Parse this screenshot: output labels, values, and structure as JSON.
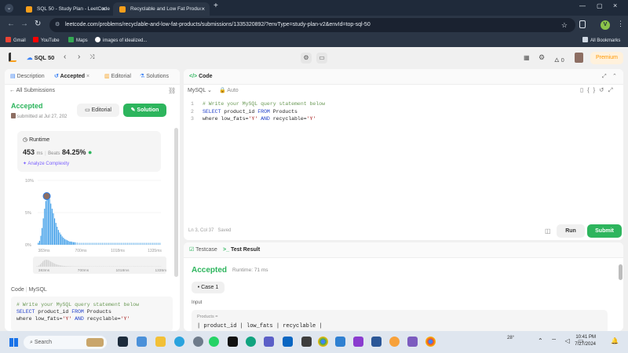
{
  "browser": {
    "tabs": [
      {
        "title": "SQL 50 - Study Plan - LeetCode",
        "active": false
      },
      {
        "title": "Recyclable and Low Fat Products",
        "active": true
      }
    ],
    "new_tab": "+",
    "url": "leetcode.com/problems/recyclable-and-low-fat-products/submissions/1335320892/?envType=study-plan-v2&envId=top-sql-50",
    "profile_initial": "V",
    "bookmarks": [
      "Gmail",
      "YouTube",
      "Maps",
      "images of idealized..."
    ],
    "all_bookmarks": "All Bookmarks"
  },
  "leetcode_nav": {
    "study_plan": "SQL 50",
    "streak_count": "0",
    "premium_label": "Premium"
  },
  "left_panel": {
    "tabs": [
      "Description",
      "Accepted",
      "Editorial",
      "Solutions"
    ],
    "all_submissions": "All Submissions",
    "status": "Accepted",
    "submitted_text": "submitted at Jul 27, 202",
    "editorial_button": "Editorial",
    "solution_button": "Solution",
    "runtime_label": "Runtime",
    "runtime_value": "453",
    "runtime_unit": "ms",
    "beats_label": "Beats",
    "beats_value": "84.25%",
    "analyze_label": "Analyze Complexity",
    "code_label": "Code",
    "lang_label": "MySQL",
    "code_lines": [
      "# Write your MySQL query statement below",
      "SELECT product_id FROM Products",
      "where low_fats='Y' AND recyclable='Y'"
    ]
  },
  "chart_data": {
    "type": "bar",
    "title": "",
    "xlabel": "",
    "ylabel": "",
    "y_ticks": [
      "10%",
      "5%",
      "0%"
    ],
    "x_ticks": [
      "383ms",
      "700ms",
      "1018ms",
      "1335ms"
    ],
    "mini_x_ticks": [
      "383ms",
      "700ms",
      "1018ms",
      "1335ms"
    ],
    "xlim": [
      383,
      1335
    ],
    "ylim": [
      0,
      10
    ],
    "highlight_x": 453,
    "values": [
      0.3,
      0.6,
      1.4,
      2.6,
      4.1,
      5.6,
      6.8,
      7.3,
      7.4,
      7.1,
      6.4,
      5.6,
      4.9,
      4.1,
      3.4,
      2.8,
      2.3,
      1.9,
      1.6,
      1.3,
      1.1,
      0.9,
      0.8,
      0.7,
      0.6,
      0.5,
      0.5,
      0.45,
      0.4,
      0.4,
      0.35,
      0.35,
      0.3,
      0.3,
      0.3,
      0.3,
      0.3,
      0.3,
      0.3,
      0.3,
      0.3,
      0.3,
      0.3,
      0.3,
      0.3,
      0.3,
      0.3,
      0.3,
      0.3,
      0.3,
      0.3,
      0.3,
      0.3,
      0.3,
      0.3,
      0.3,
      0.3,
      0.3,
      0.3,
      0.3,
      0.3,
      0.3,
      0.3,
      0.3,
      0.3,
      0.3,
      0.3,
      0.3,
      0.3,
      0.3,
      0.3,
      0.3,
      0.3,
      0.3,
      0.3,
      0.3,
      0.3,
      0.3,
      0.3,
      0.3,
      0.3,
      0.3,
      0.3,
      0.3,
      0.3,
      0.3,
      0.3,
      0.3,
      0.3,
      0.3,
      0.3,
      0.3,
      0.3,
      0.3,
      0.3,
      0.3,
      0.3,
      0.3
    ],
    "grid": true
  },
  "editor": {
    "title": "Code",
    "language": "MySQL",
    "mode": "Auto",
    "line_numbers": [
      "1",
      "2",
      "3"
    ],
    "cursor_position": "Ln 3, Col 37",
    "saved": "Saved",
    "run_button": "Run",
    "submit_button": "Submit"
  },
  "result_panel": {
    "tabs": [
      "Testcase",
      "Test Result"
    ],
    "status": "Accepted",
    "runtime": "Runtime: 71 ms",
    "case_label": "Case 1",
    "input_label": "Input",
    "table_name": "Products =",
    "table_header": "| product_id | low_fats | recyclable |"
  },
  "taskbar": {
    "search_placeholder": "Search",
    "weather": "28°",
    "time": "10:41 PM",
    "date": "7/27/2024"
  }
}
